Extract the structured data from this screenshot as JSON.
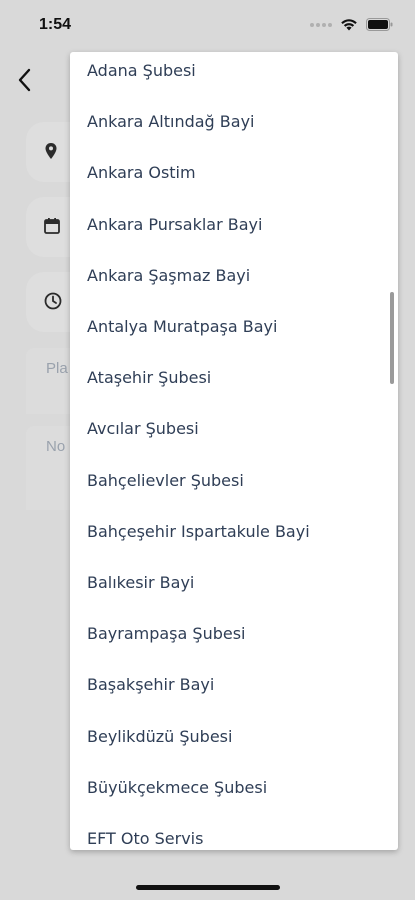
{
  "status_bar": {
    "time": "1:54"
  },
  "form": {
    "plate_placeholder": "Pla",
    "note_placeholder": "No"
  },
  "dropdown": {
    "items": [
      "Adana Şubesi",
      "Ankara Altındağ Bayi",
      "Ankara Ostim",
      "Ankara Pursaklar Bayi",
      "Ankara Şaşmaz Bayi",
      "Antalya Muratpaşa Bayi",
      "Ataşehir Şubesi",
      "Avcılar Şubesi",
      "Bahçelievler Şubesi",
      "Bahçeşehir Ispartakule Bayi",
      "Balıkesir Bayi",
      "Bayrampaşa Şubesi",
      "Başakşehir Bayi",
      "Beylikdüzü Şubesi",
      "Büyükçekmece Şubesi",
      "EFT Oto Servis"
    ]
  },
  "icons": {
    "back": "chevron-left-icon",
    "location": "location-pin-icon",
    "date": "calendar-icon",
    "time": "clock-icon"
  }
}
